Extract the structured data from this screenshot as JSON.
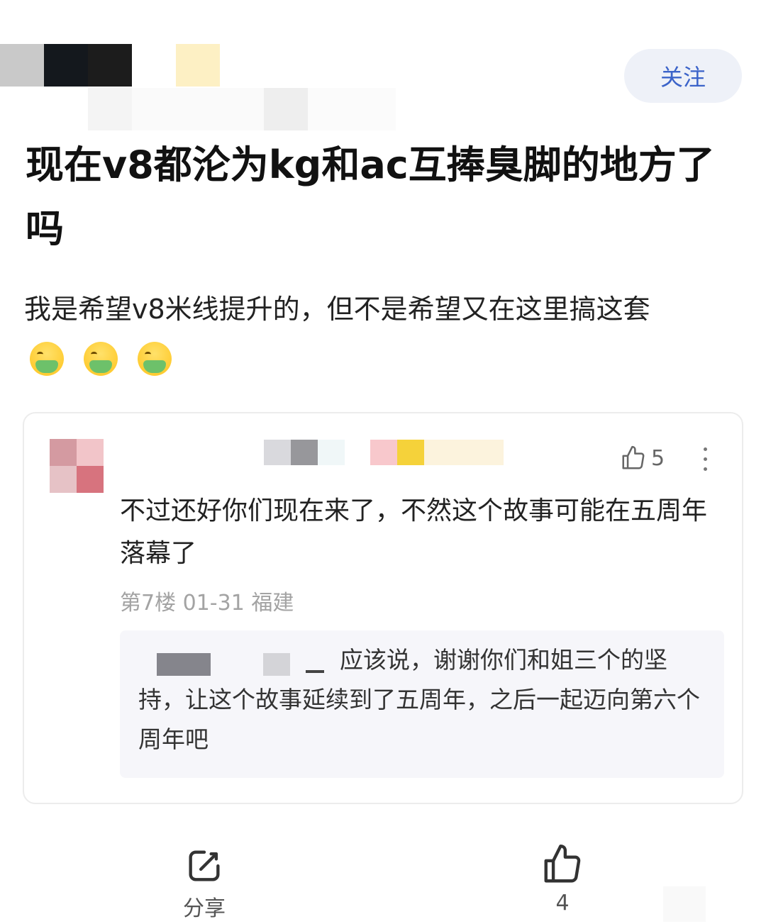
{
  "header": {
    "follow_label": "关注"
  },
  "post": {
    "title": "现在v8都沦为kg和ac互捧臭脚的地方了吗",
    "body": "我是希望v8米线提升的，但不是希望又在这里搞这套",
    "emoji_count": 3,
    "emoji_icon": "nauseated-face-icon"
  },
  "comment": {
    "likes": "5",
    "text": "不过还好你们现在来了，不然这个故事可能在五周年落幕了",
    "meta": "第7楼 01-31 福建",
    "reply": {
      "text": "应该说，谢谢你们和姐三个的坚持，让这个故事延续到了五周年，之后一起迈向第六个周年吧"
    }
  },
  "bottom_bar": {
    "share_label": "分享",
    "like_count": "4"
  },
  "colors": {
    "accent": "#3b63c9",
    "follow_bg": "#eef1f8",
    "meta_gray": "#a3a3a3",
    "reply_bg": "#f6f6fa"
  }
}
